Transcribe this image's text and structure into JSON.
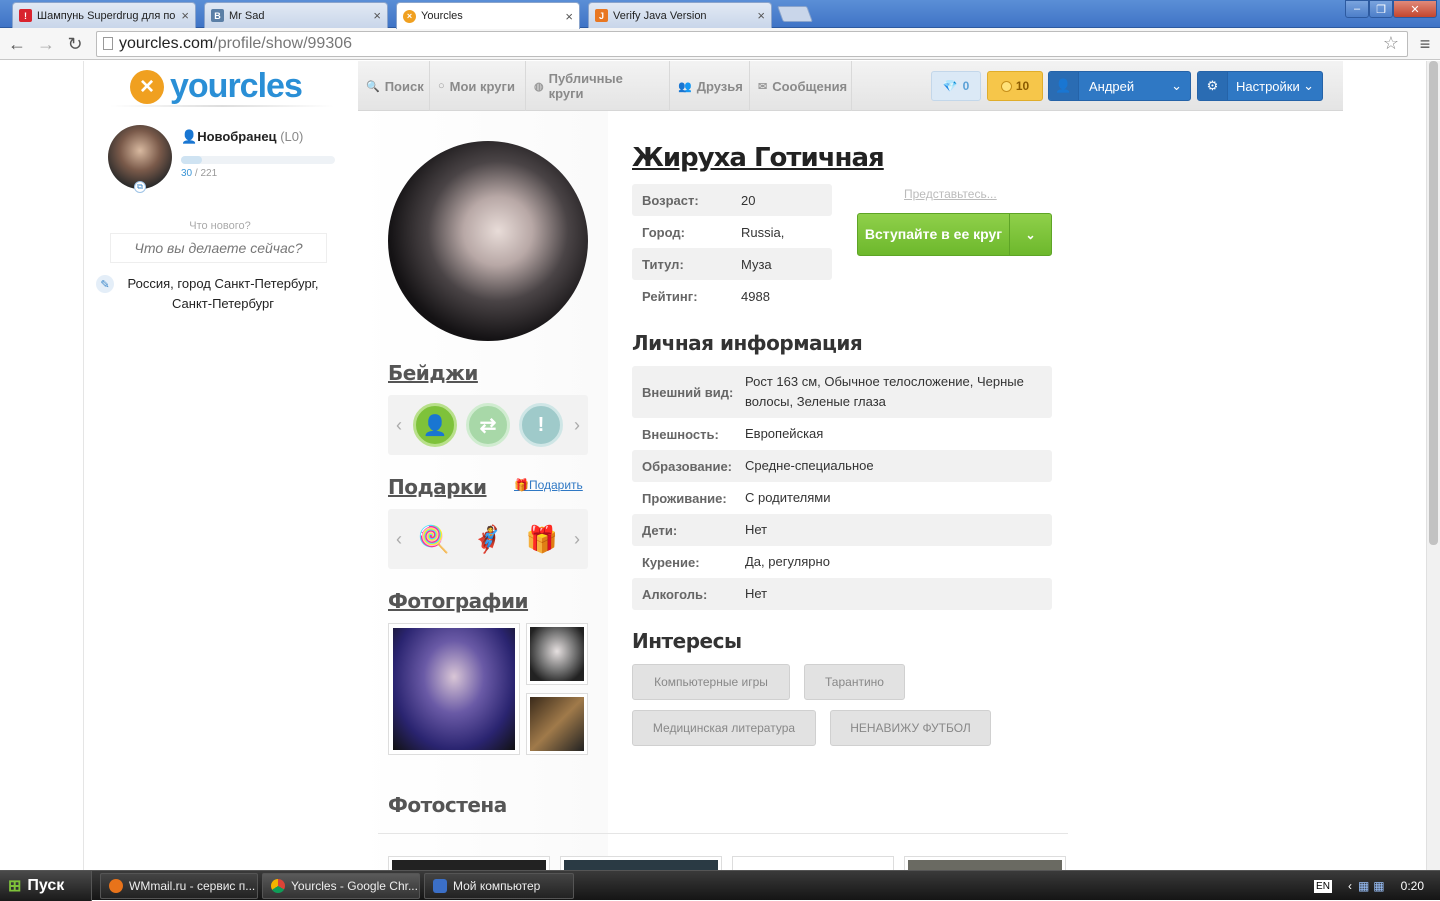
{
  "browser": {
    "tabs": [
      {
        "title": "Шампунь Superdrug для по",
        "favicon_color": "#d9232e",
        "favicon_glyph": "!"
      },
      {
        "title": "Mr Sad",
        "favicon_color": "#5b7fa6",
        "favicon_glyph": "В"
      },
      {
        "title": "Yourcles",
        "favicon_color": "#f0a020",
        "favicon_glyph": "×"
      },
      {
        "title": "Verify Java Version",
        "favicon_color": "#e87722",
        "favicon_glyph": "J"
      }
    ],
    "url_host": "yourcles.com",
    "url_path": "/profile/show/99306"
  },
  "site": {
    "logo_text": "yourcles",
    "nav": [
      {
        "label": "Поиск",
        "icon": "search-icon"
      },
      {
        "label": "Мои круги",
        "icon": "circle-icon"
      },
      {
        "label": "Публичные круги",
        "icon": "globe-icon"
      },
      {
        "label": "Друзья",
        "icon": "friends-icon"
      },
      {
        "label": "Сообщения",
        "icon": "mail-icon"
      }
    ],
    "gems": "0",
    "coins": "10",
    "user_name": "Андрей",
    "settings_label": "Настройки"
  },
  "me": {
    "rank": "Новобранец",
    "level": "(L0)",
    "xp_current": "30",
    "xp_total": "/ 221",
    "xp_fraction": 0.136,
    "whats_new_label": "Что нового?",
    "whats_new_placeholder": "Что вы делаете сейчас?",
    "location": "Россия, город Санкт-Петербург, Санкт-Петербург"
  },
  "profile": {
    "name": "Жируха Готичная",
    "stats": [
      {
        "key": "Возраст:",
        "value": "20"
      },
      {
        "key": "Город:",
        "value": "Russia,"
      },
      {
        "key": "Титул:",
        "value": "Муза"
      },
      {
        "key": "Рейтинг:",
        "value": "4988"
      }
    ],
    "intro_link": "Представьтесь...",
    "join_button": "Вступайте в ее круг",
    "badges_title": "Бейджи",
    "gifts_title": "Подарки",
    "give_link": "Подарить",
    "photos_title": "Фотографии",
    "personal_title": "Личная информация",
    "personal": [
      {
        "key": "Внешний вид:",
        "value": "Рост 163 см, Обычное телосложение, Черные волосы, Зеленые глаза"
      },
      {
        "key": "Внешность:",
        "value": "Европейская"
      },
      {
        "key": "Образование:",
        "value": "Средне-специальное"
      },
      {
        "key": "Проживание:",
        "value": "С родителями"
      },
      {
        "key": "Дети:",
        "value": "Нет"
      },
      {
        "key": "Курение:",
        "value": "Да, регулярно"
      },
      {
        "key": "Алкоголь:",
        "value": "Нет"
      }
    ],
    "interests_title": "Интересы",
    "interests": [
      "Компьютерные игры",
      "Тарантино",
      "Медицинская литература",
      "НЕНАВИЖУ ФУТБОЛ"
    ],
    "wall_title": "Фотостена"
  },
  "taskbar": {
    "start": "Пуск",
    "items": [
      "WMmail.ru - сервис п...",
      "Yourcles - Google Chr...",
      "Мой компьютер"
    ],
    "lang": "EN",
    "clock": "0:20"
  }
}
